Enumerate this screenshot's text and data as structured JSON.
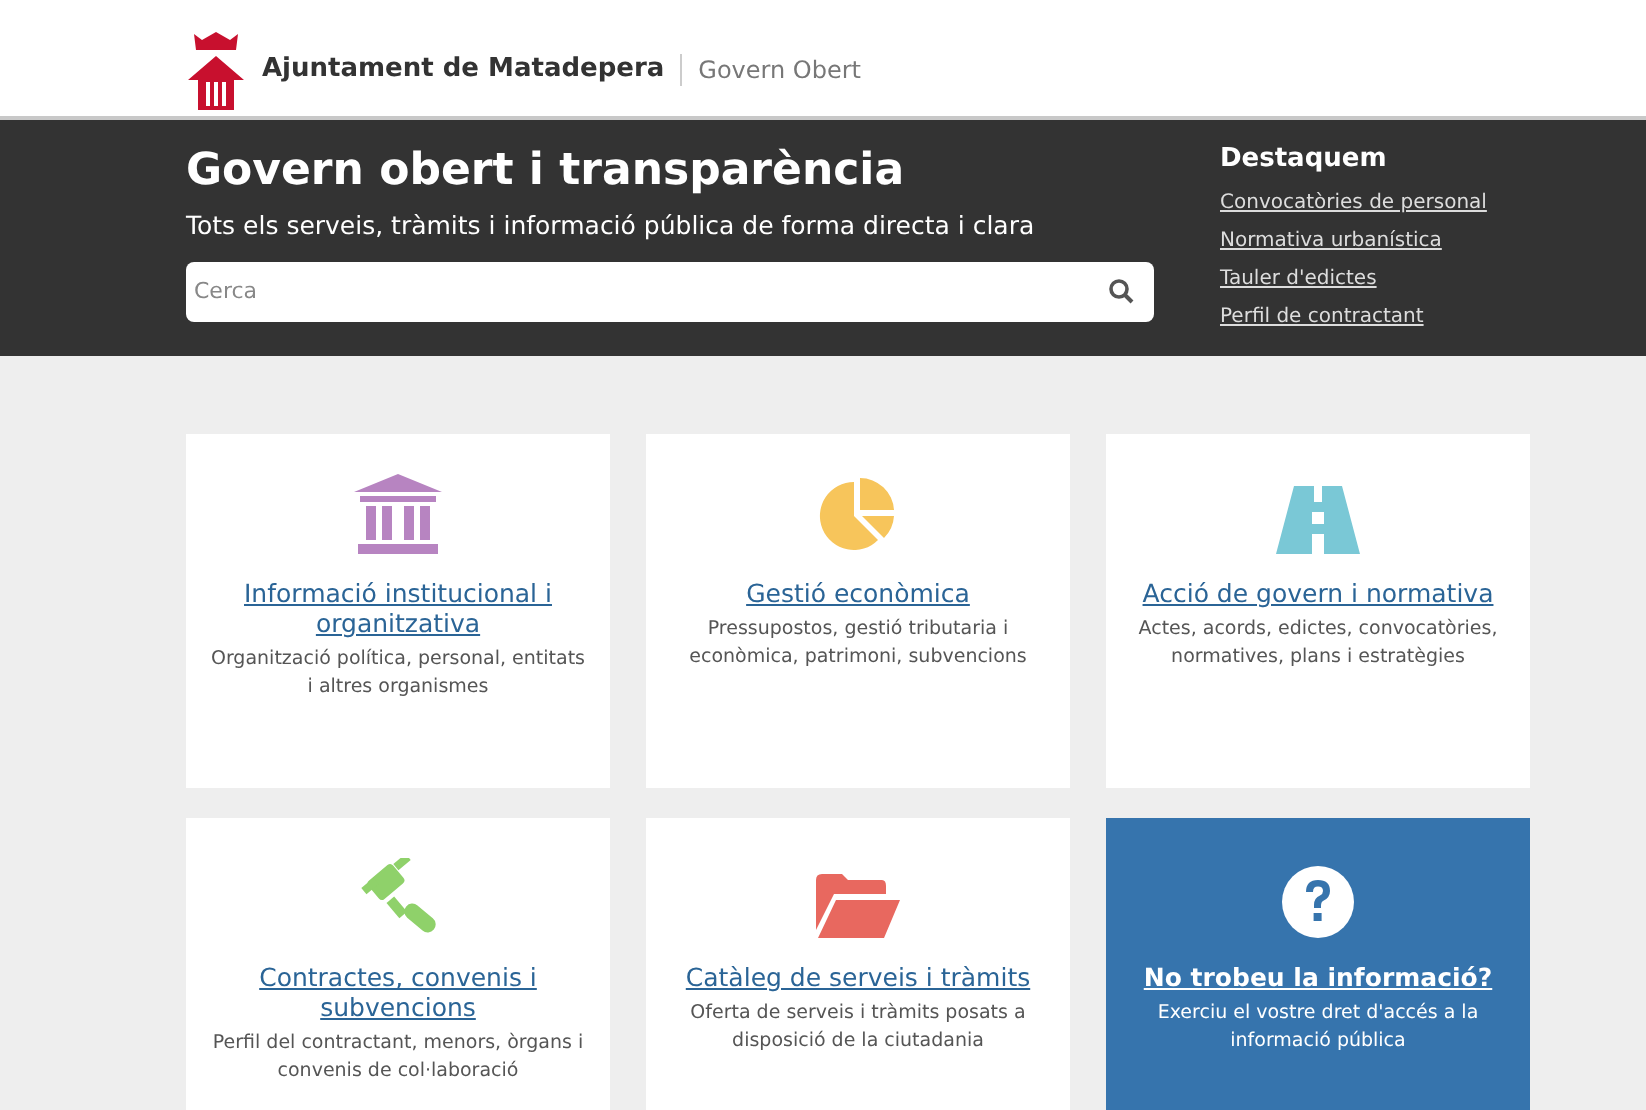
{
  "header": {
    "org_name": "Ajuntament de Matadepera",
    "section": "Govern Obert"
  },
  "hero": {
    "title": "Govern obert i transparència",
    "subtitle": "Tots els serveis, tràmits i informació pública de forma directa i clara",
    "search": {
      "placeholder": "Cerca"
    }
  },
  "highlights": {
    "title": "Destaquem",
    "links": [
      "Convocatòries de personal",
      "Normativa urbanística",
      "Tauler d'edictes",
      "Perfil de contractant"
    ]
  },
  "cards": [
    {
      "kind": "topic",
      "title": "Informació institucional i organitzativa",
      "description": "Organització política, personal, entitats i altres organismes"
    },
    {
      "kind": "topic",
      "title": "Gestió econòmica",
      "description": "Pressupostos, gestió tributaria i econòmica, patrimoni, subvencions"
    },
    {
      "kind": "topic",
      "title": "Acció de govern i normativa",
      "description": "Actes, acords, edictes, convocatòries, normatives, plans i estratègies"
    },
    {
      "kind": "topic",
      "title": "Contractes, convenis i subvencions",
      "description": "Perfil del contractant, menors, òrgans i convenis de col·laboració"
    },
    {
      "kind": "topic",
      "title": "Catàleg de serveis i tràmits",
      "description": "Oferta de serveis i tràmits posats a disposició de la ciutadania"
    },
    {
      "kind": "help",
      "title": "No trobeu la informació?",
      "description": "Exerciu el vostre dret d'accés a la informació pública"
    }
  ]
}
